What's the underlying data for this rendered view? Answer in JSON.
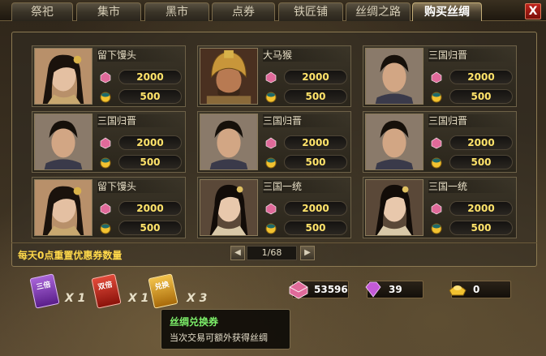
{
  "tabs": [
    {
      "label": "祭祀",
      "active": false
    },
    {
      "label": "集市",
      "active": false
    },
    {
      "label": "黑市",
      "active": false
    },
    {
      "label": "点券",
      "active": false
    },
    {
      "label": "铁匠铺",
      "active": false
    },
    {
      "label": "丝绸之路",
      "active": false
    },
    {
      "label": "购买丝绸",
      "active": true
    }
  ],
  "close_label": "X",
  "cards": [
    {
      "name": "留下馒头",
      "portrait": "female-1",
      "silk_price": "2000",
      "gold_price": "500"
    },
    {
      "name": "大马猴",
      "portrait": "warrior-helmet",
      "silk_price": "2000",
      "gold_price": "500"
    },
    {
      "name": "三国归晋",
      "portrait": "male-1",
      "silk_price": "2000",
      "gold_price": "500"
    },
    {
      "name": "三国归晋",
      "portrait": "male-1",
      "silk_price": "2000",
      "gold_price": "500"
    },
    {
      "name": "三国归晋",
      "portrait": "male-1",
      "silk_price": "2000",
      "gold_price": "500"
    },
    {
      "name": "三国归晋",
      "portrait": "male-1",
      "silk_price": "2000",
      "gold_price": "500"
    },
    {
      "name": "留下馒头",
      "portrait": "female-1",
      "silk_price": "2000",
      "gold_price": "500"
    },
    {
      "name": "三国一统",
      "portrait": "female-2",
      "silk_price": "2000",
      "gold_price": "500"
    },
    {
      "name": "三国一统",
      "portrait": "female-2",
      "silk_price": "2000",
      "gold_price": "500"
    }
  ],
  "daily_note": "每天0点重置优惠券数量",
  "pager": {
    "text": "1/68",
    "prev": "◀",
    "next": "▶"
  },
  "coupons": [
    {
      "label": "三倍",
      "count": "X 1",
      "color": "#8a3fbf"
    },
    {
      "label": "双倍",
      "count": "X 1",
      "color": "#c2241c"
    },
    {
      "label": "兑换",
      "count": "X 3",
      "color": "#d89a1e"
    }
  ],
  "resources": {
    "silk": "53596",
    "gem": "39",
    "gold": "0"
  },
  "tooltip": {
    "title": "丝绸兑换券",
    "desc": "当次交易可额外获得丝绸"
  },
  "colors": {
    "silk_icon": "#e06a9a",
    "gold_icon": "#f2c230",
    "price_text": "#ffe36a",
    "note_text": "#ffd84a"
  }
}
